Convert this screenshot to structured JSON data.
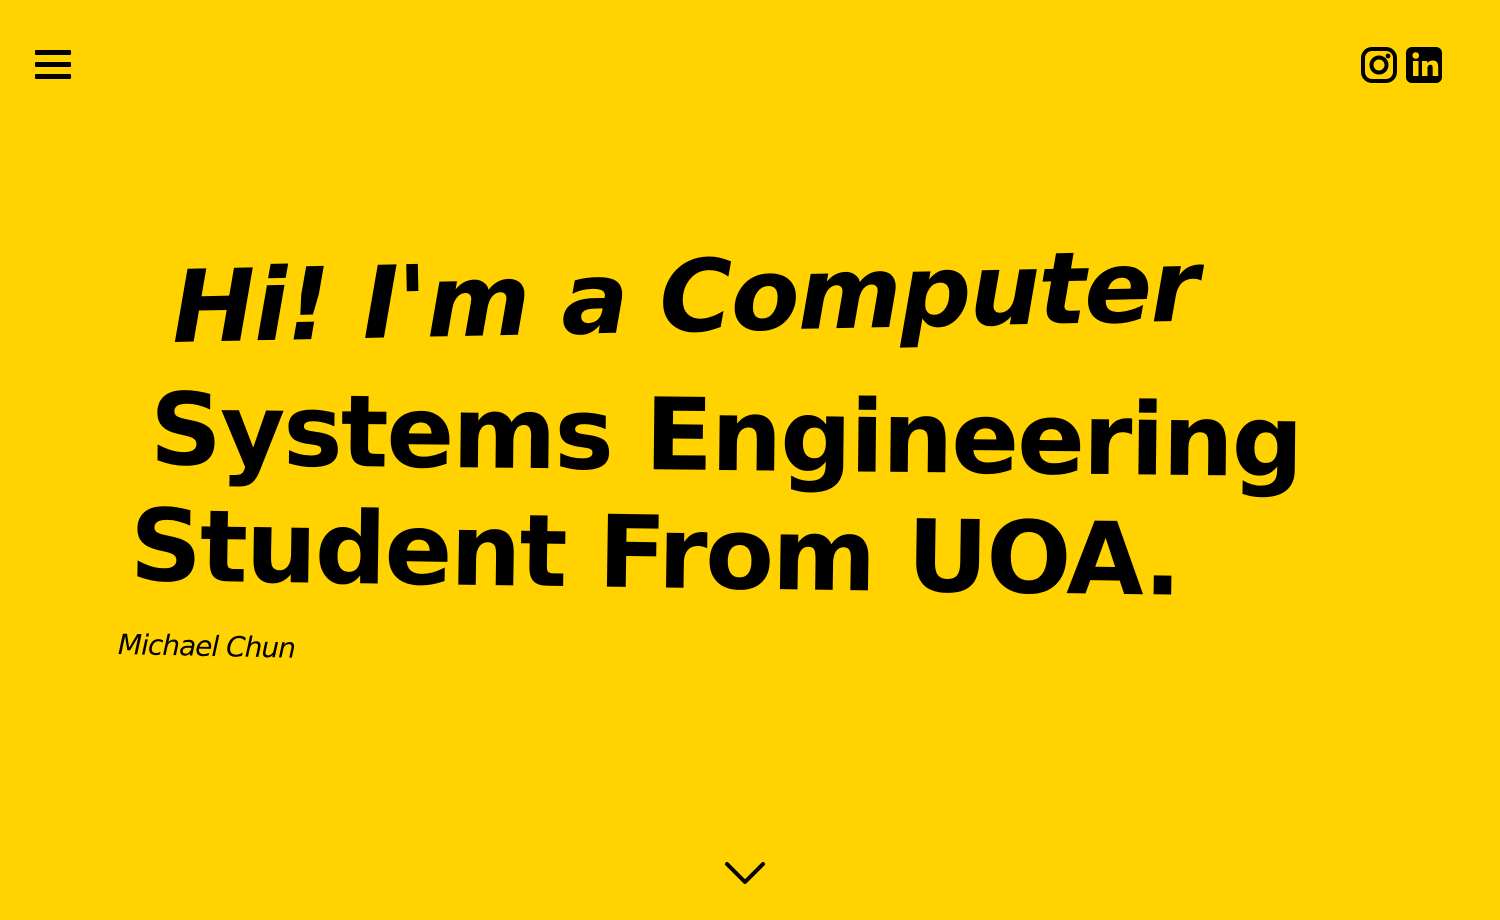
{
  "header": {
    "menu_icon": "hamburger-menu-icon",
    "social": [
      {
        "icon": "instagram-icon"
      },
      {
        "icon": "linkedin-icon"
      }
    ]
  },
  "hero": {
    "headline_lines": [
      "Hi! I'm a Computer",
      "Systems Engineering",
      "Student From UOA."
    ],
    "author": "Michael Chun"
  },
  "scroll_indicator": {
    "icon": "chevron-down-icon"
  },
  "colors": {
    "background": "#FFD200",
    "text": "#000000"
  }
}
